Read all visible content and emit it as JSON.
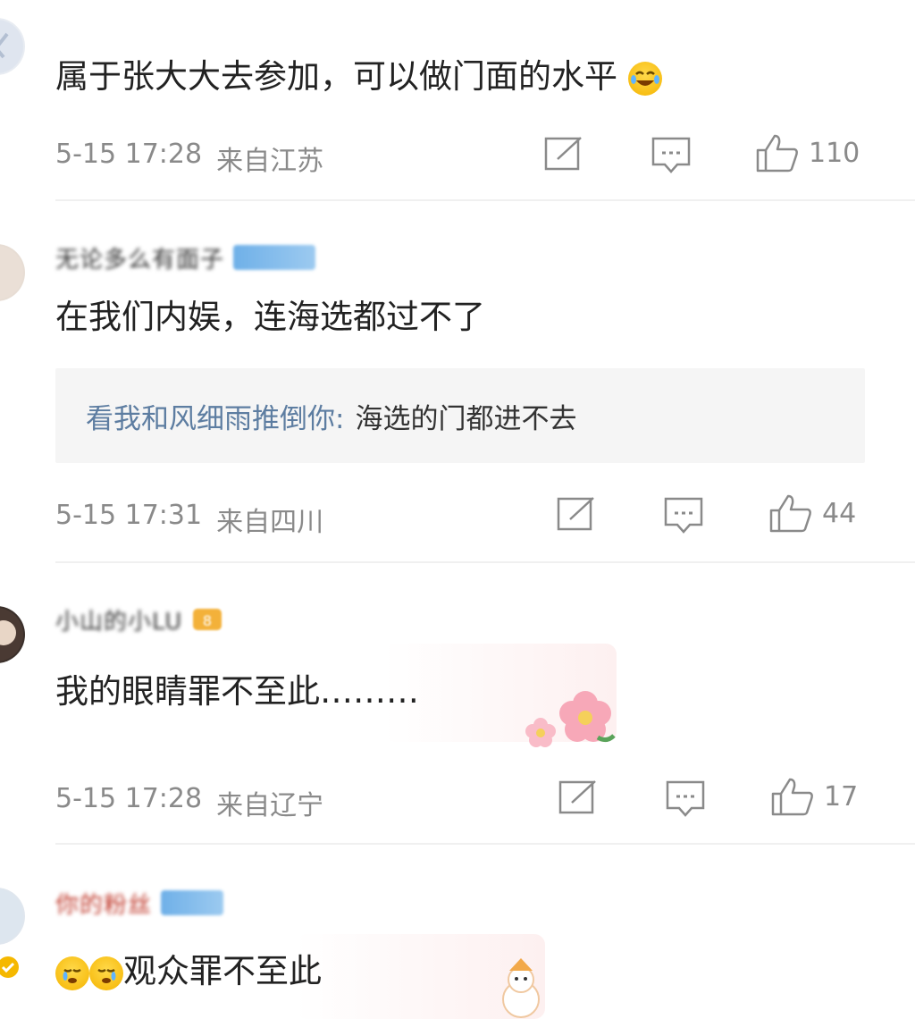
{
  "comments": [
    {
      "text": "属于张大大去参加，可以做门面的水平",
      "emoji": "laughing-tears-emoji",
      "time": "5-15 17:28",
      "location": "来自江苏",
      "likes": "110"
    },
    {
      "username": "无论多么有面子",
      "text": "在我们内娱，连海选都过不了",
      "reply_name": "看我和风细雨推倒你:",
      "reply_text": "海选的门都进不去",
      "time": "5-15 17:31",
      "location": "来自四川",
      "likes": "44"
    },
    {
      "username": "小山的小LU",
      "text": "我的眼睛罪不至此………",
      "time": "5-15 17:28",
      "location": "来自辽宁",
      "likes": "17"
    },
    {
      "username": "你的粉丝",
      "text": "观众罪不至此",
      "emoji": "crying-emoji"
    }
  ],
  "icons": {
    "share": "share-icon",
    "comment": "comment-icon",
    "like": "thumbs-up-icon"
  },
  "colors": {
    "meta": "#8a8a8a",
    "reply_name": "#5d7da1",
    "reply_bg": "#f5f5f5"
  }
}
